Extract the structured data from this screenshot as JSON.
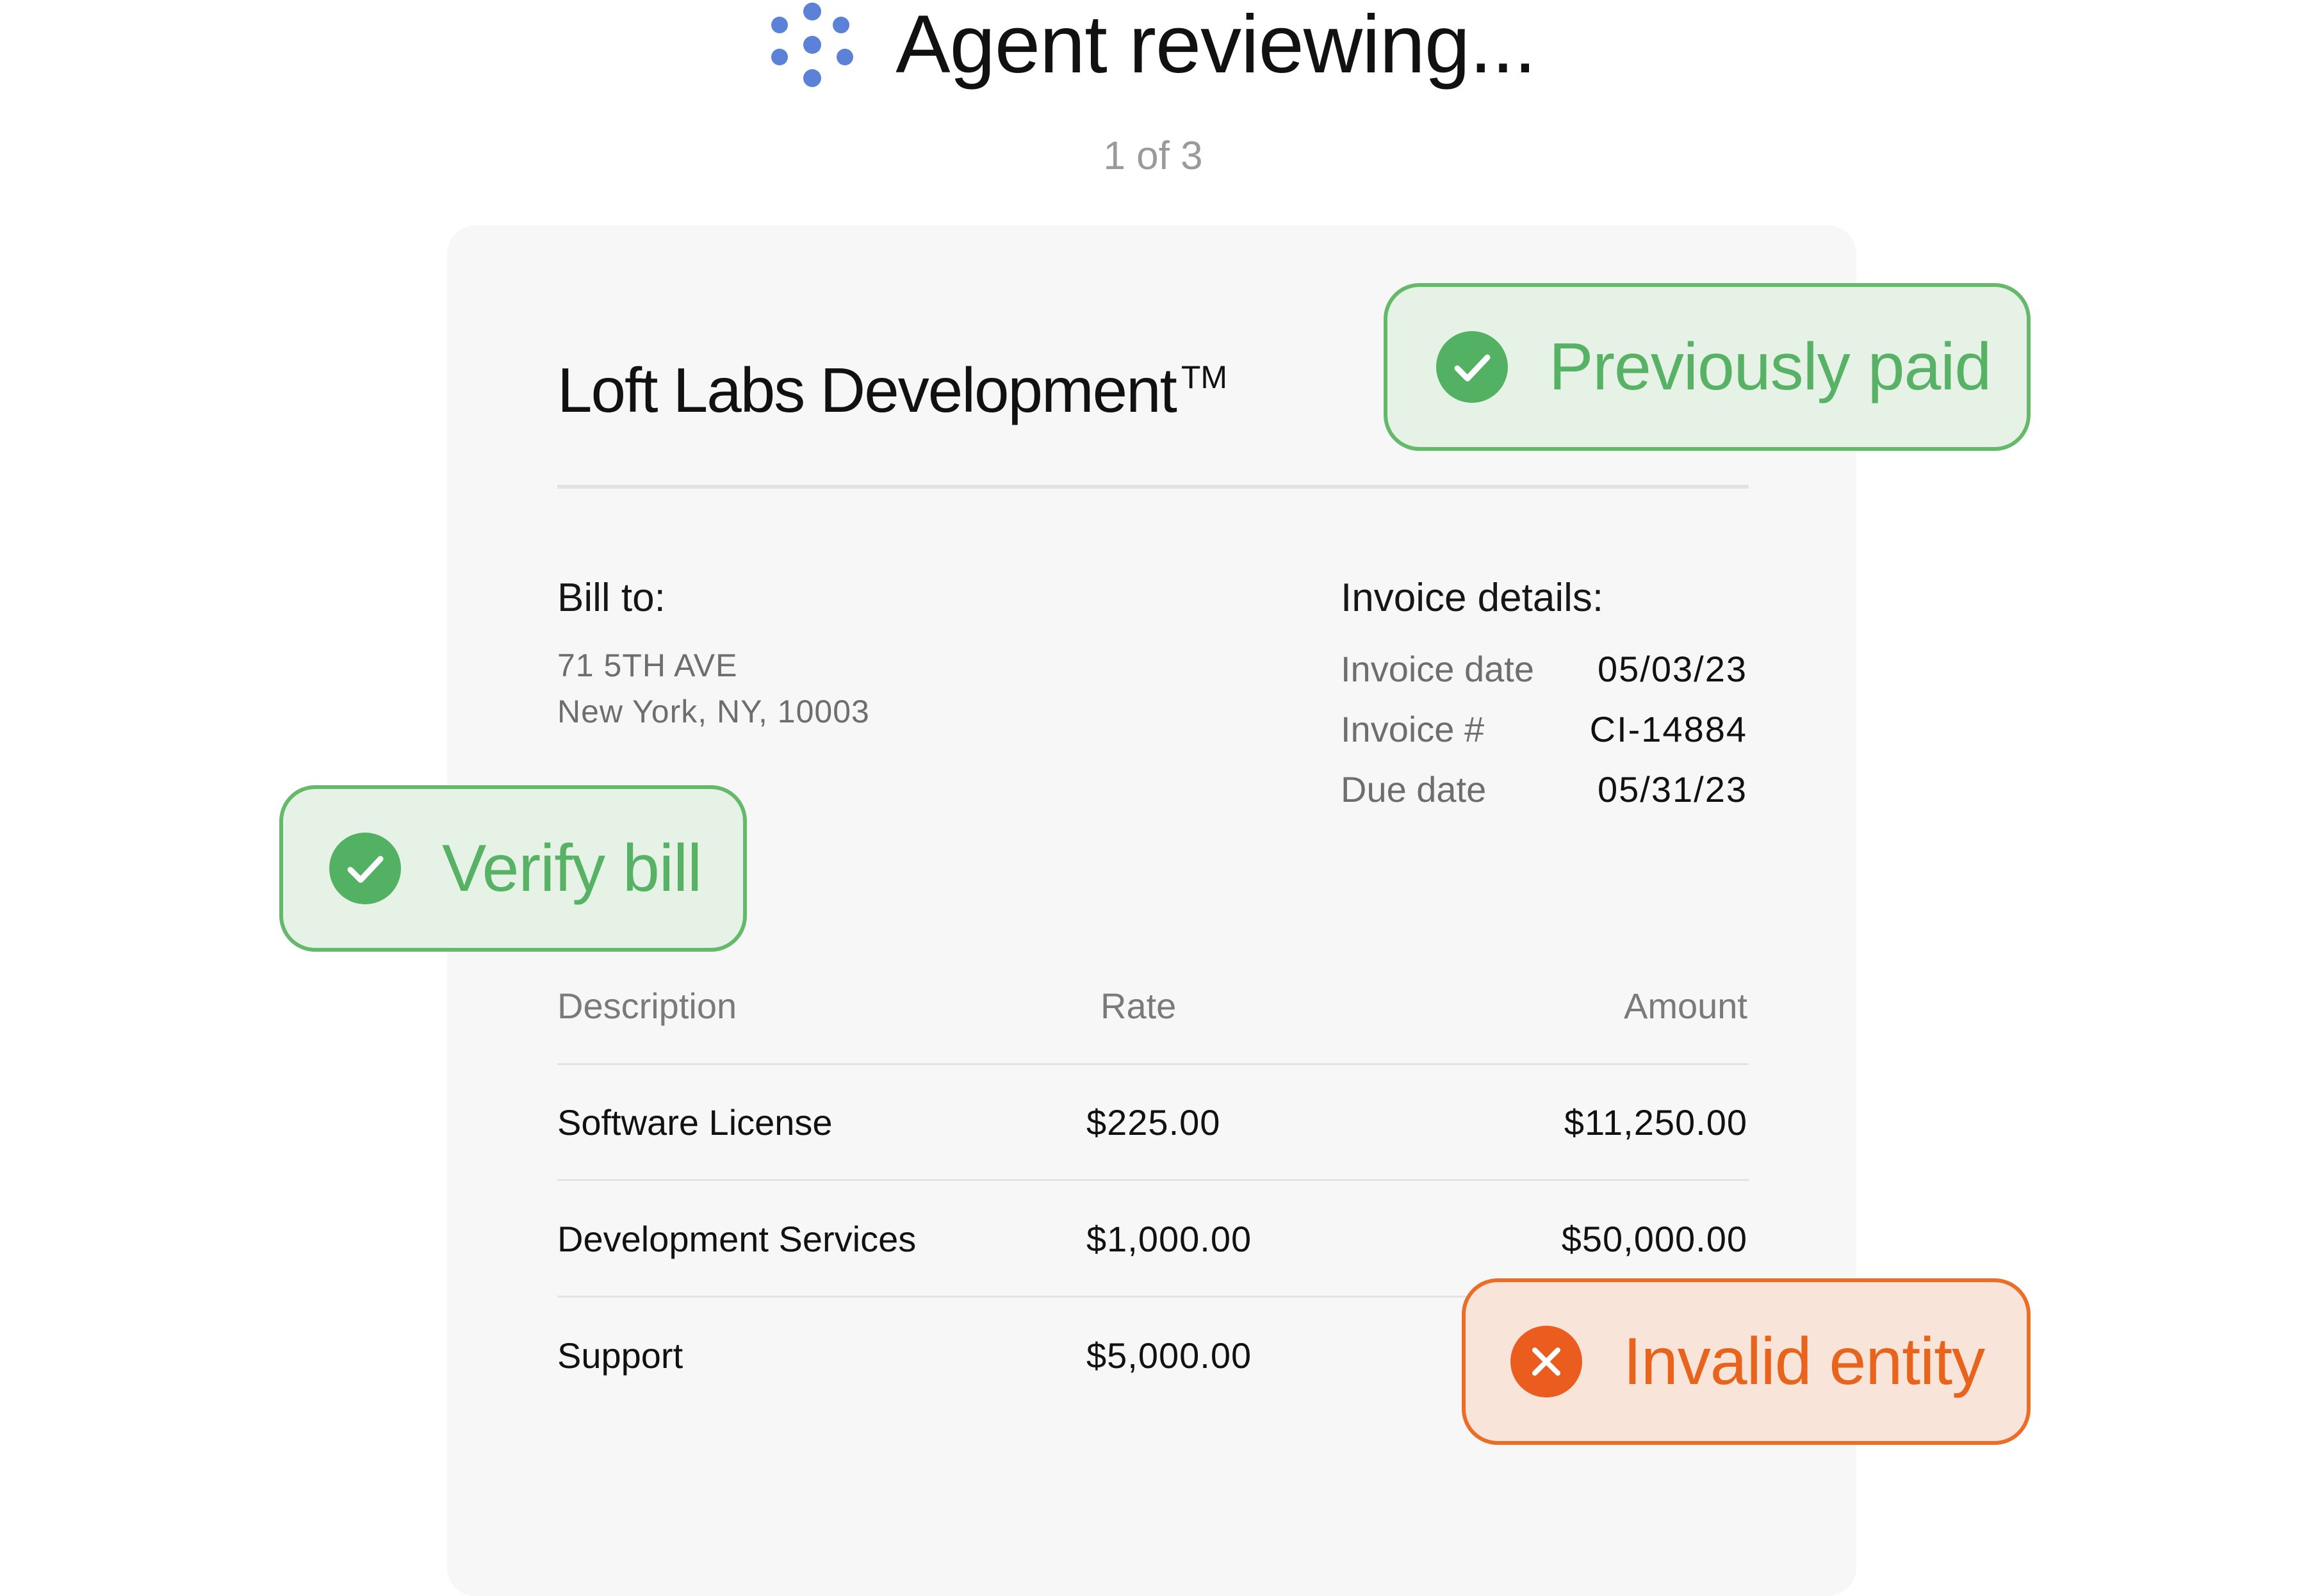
{
  "header": {
    "title": "Agent reviewing...",
    "spinner_icon": "loading-dots-icon",
    "accent_color": "#5b82d6",
    "pager": "1 of 3"
  },
  "invoice": {
    "company": "Loft Labs Development",
    "trademark": "TM",
    "bill_to": {
      "label": "Bill to:",
      "address_line1": "71 5TH AVE",
      "address_line2": "New York, NY, 10003"
    },
    "details": {
      "label": "Invoice details:",
      "invoice_date_label": "Invoice date",
      "invoice_date": "05/03/23",
      "invoice_number_label": "Invoice #",
      "invoice_number": "CI-14884",
      "due_date_label": "Due date",
      "due_date": "05/31/23"
    },
    "table": {
      "columns": [
        "Description",
        "Rate",
        "Amount"
      ],
      "rows": [
        {
          "description": "Software License",
          "rate": "$225.00",
          "amount": "$11,250.00"
        },
        {
          "description": "Development Services",
          "rate": "$1,000.00",
          "amount": "$50,000.00"
        },
        {
          "description": "Support",
          "rate": "$5,000.00",
          "amount": ""
        }
      ]
    }
  },
  "badges": {
    "previously_paid": {
      "label": "Previously paid",
      "icon": "check-circle-icon",
      "status": "success",
      "color": "#58b266"
    },
    "verify_bill": {
      "label": "Verify bill",
      "icon": "check-circle-icon",
      "status": "success",
      "color": "#58b266"
    },
    "invalid_entity": {
      "label": "Invalid entity",
      "icon": "x-circle-icon",
      "status": "error",
      "color": "#e8631b"
    }
  }
}
